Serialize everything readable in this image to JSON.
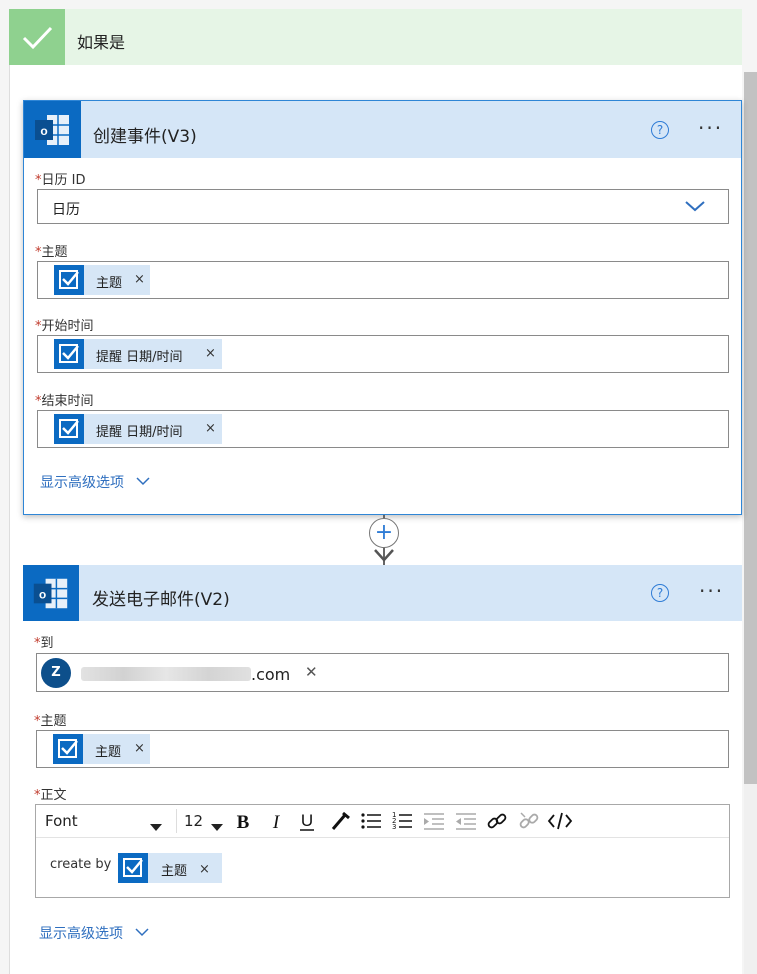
{
  "branch": {
    "title": "如果是"
  },
  "card1": {
    "title": "创建事件(V3)",
    "help": "?",
    "more": "···",
    "fields": {
      "calendar": {
        "label": "日历 ID",
        "value": "日历"
      },
      "subject": {
        "label": "主题",
        "token": "主题"
      },
      "start": {
        "label": "开始时间",
        "token": "提醒 日期/时间"
      },
      "end": {
        "label": "结束时间",
        "token": "提醒 日期/时间"
      }
    },
    "advanced": "显示高级选项"
  },
  "connector": {
    "plus": "+"
  },
  "card2": {
    "title": "发送电子邮件(V2)",
    "help": "?",
    "more": "···",
    "to": {
      "label": "到",
      "avatar": "Z",
      "email_suffix": ".com",
      "remove": "✕"
    },
    "subject": {
      "label": "主题",
      "token": "主题"
    },
    "body": {
      "label": "正文",
      "font": "Font",
      "size": "12",
      "prefix": "create by",
      "token": "主题"
    },
    "advanced": "显示高级选项"
  },
  "common": {
    "required": "*",
    "token_remove": "×"
  },
  "colors": {
    "accent": "#0b6ac2",
    "header": "#d5e6f7",
    "branch": "#e6f5e6",
    "check": "#8fd18f"
  }
}
